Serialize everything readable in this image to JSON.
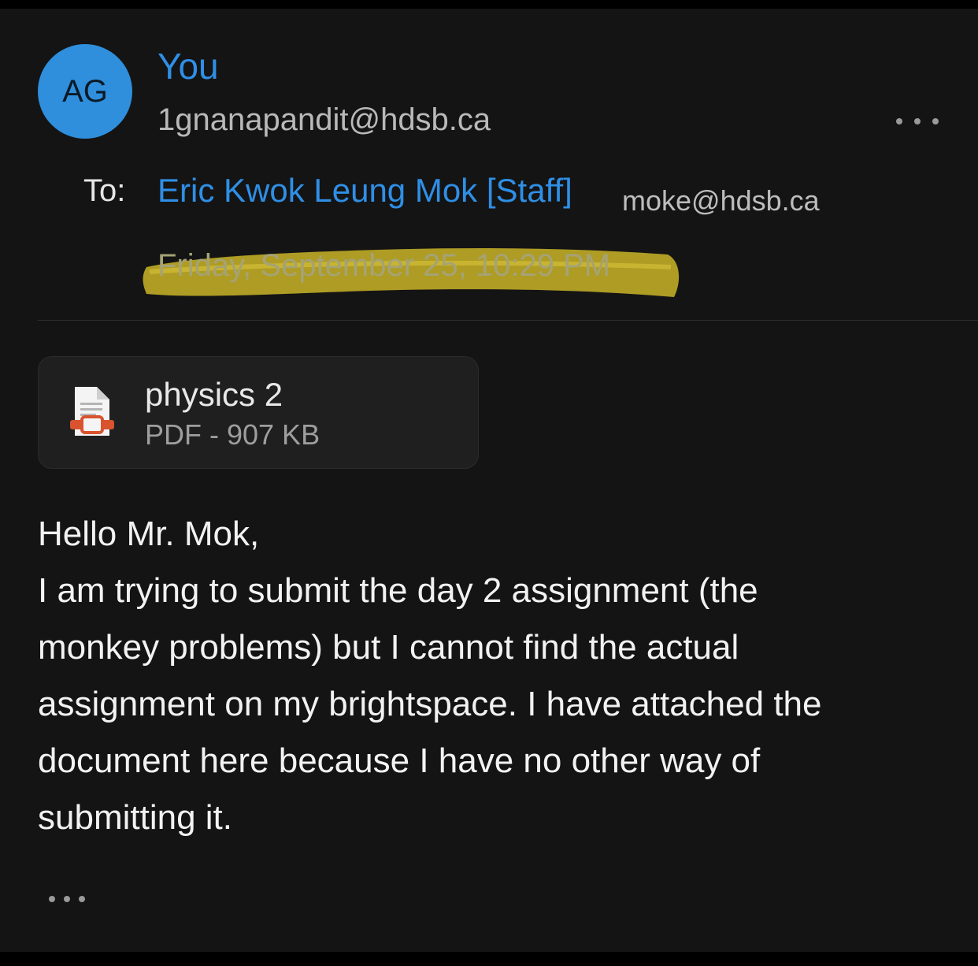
{
  "sender": {
    "initials": "AG",
    "name": "You",
    "email": "1gnanapandit@hdsb.ca",
    "avatar_color": "#2f8fdc"
  },
  "recipient": {
    "to_label": "To:",
    "name": "Eric Kwok Leung Mok [Staff]",
    "email": "moke@hdsb.ca"
  },
  "date": "Friday, September 25, 10:29 PM",
  "highlight_color": "#c9b427",
  "attachment": {
    "name": "physics 2",
    "meta": "PDF - 907 KB",
    "icon": "pdf-file-icon"
  },
  "body": {
    "lines": [
      "Hello Mr. Mok,",
      "I am trying to submit the day 2 assignment (the",
      "monkey problems) but I cannot find the actual",
      "assignment on my brightspace. I have attached the",
      "document here because I have no other way of",
      "submitting it."
    ]
  },
  "icons": {
    "more": "more-horizontal-icon",
    "show_quoted": "ellipsis-icon"
  }
}
